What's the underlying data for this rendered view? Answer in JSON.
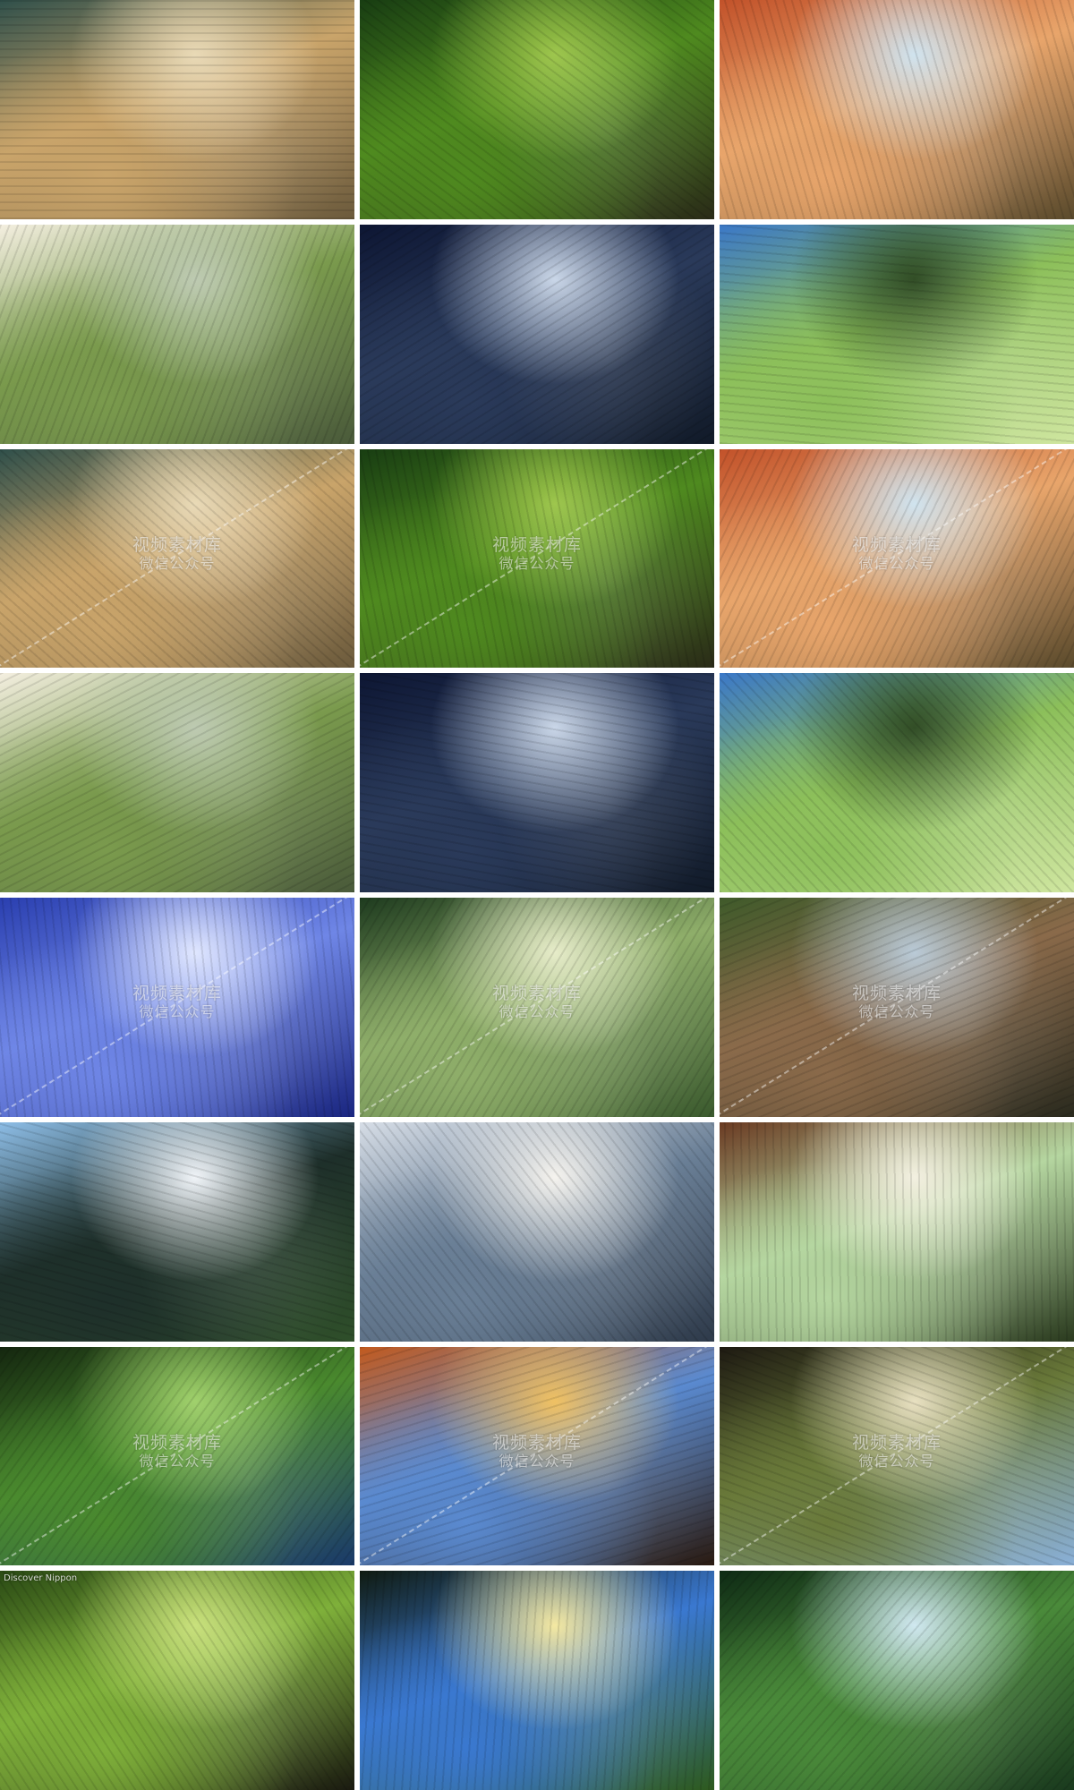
{
  "gallery": {
    "columns": 3,
    "rows": 8,
    "tiles": [
      {
        "scene": "frosted-grass-bokeh",
        "colors": [
          "#2f4f4a",
          "#c9a46a",
          "#e9d9b5",
          "#6b5a3c"
        ]
      },
      {
        "scene": "mossy-tree-roots",
        "colors": [
          "#183d12",
          "#4f8a1f",
          "#9cc54a",
          "#2a2b18"
        ]
      },
      {
        "scene": "autumn-tree-by-lake",
        "colors": [
          "#c2522a",
          "#e8a56b",
          "#cfe3ef",
          "#5a4a2c"
        ]
      },
      {
        "scene": "snowy-pine-branch-sunlight",
        "colors": [
          "#f4efe0",
          "#7a9a4d",
          "#bcc9b0",
          "#4a5a3a"
        ]
      },
      {
        "scene": "misty-dark-forest-light",
        "colors": [
          "#0d1633",
          "#2a3a5a",
          "#c9d6e8",
          "#111a28"
        ]
      },
      {
        "scene": "green-canopy-blue-sky",
        "colors": [
          "#3b78c8",
          "#8cbf5a",
          "#2e4a22",
          "#cfe6a0"
        ]
      },
      {
        "scene": "frosted-grass-bokeh",
        "colors": [
          "#2f4f4a",
          "#c9a46a",
          "#e9d9b5",
          "#6b5a3c"
        ]
      },
      {
        "scene": "mossy-tree-roots",
        "colors": [
          "#183d12",
          "#4f8a1f",
          "#9cc54a",
          "#2a2b18"
        ]
      },
      {
        "scene": "autumn-tree-by-lake",
        "colors": [
          "#c2522a",
          "#e8a56b",
          "#cfe3ef",
          "#5a4a2c"
        ]
      },
      {
        "scene": "snowy-pine-branch-sunlight",
        "colors": [
          "#f4efe0",
          "#7a9a4d",
          "#bcc9b0",
          "#4a5a3a"
        ]
      },
      {
        "scene": "misty-dark-forest-light",
        "colors": [
          "#0d1633",
          "#2a3a5a",
          "#c9d6e8",
          "#111a28"
        ]
      },
      {
        "scene": "green-canopy-blue-sky",
        "colors": [
          "#3b78c8",
          "#8cbf5a",
          "#2e4a22",
          "#cfe6a0"
        ]
      },
      {
        "scene": "aerial-snowy-forest-blue",
        "colors": [
          "#2a3fb0",
          "#6f86e6",
          "#dfe6ff",
          "#1a2680"
        ]
      },
      {
        "scene": "misty-pine-clearing",
        "colors": [
          "#1d3a1e",
          "#8fae6a",
          "#e6ecc8",
          "#3b5a2e"
        ]
      },
      {
        "scene": "oak-tree-meadow-path",
        "colors": [
          "#3f5a2a",
          "#8a6a4a",
          "#b8c9d6",
          "#2a2a1e"
        ]
      },
      {
        "scene": "snowy-mountain-pines",
        "colors": [
          "#8dbde6",
          "#1e2f2a",
          "#f0f4f8",
          "#2f4f2a"
        ]
      },
      {
        "scene": "snow-covered-fir-trees",
        "colors": [
          "#d6dde6",
          "#6a7f96",
          "#f5f3ee",
          "#2e3a4a"
        ]
      },
      {
        "scene": "sequoia-forest-sunlight",
        "colors": [
          "#6a3a22",
          "#b5d6a0",
          "#f3f0e0",
          "#2a3a1e"
        ]
      },
      {
        "scene": "canopy-looking-up-green",
        "colors": [
          "#14260f",
          "#4a8a2e",
          "#9fd06a",
          "#1a3a6a"
        ]
      },
      {
        "scene": "autumn-canopy-blue-sky",
        "colors": [
          "#c25a1e",
          "#5a8ad0",
          "#f0c060",
          "#2a1a10"
        ]
      },
      {
        "scene": "oak-branches-sunburst",
        "colors": [
          "#1e1a12",
          "#6a7a3a",
          "#e8e0c0",
          "#8ab0d8"
        ]
      },
      {
        "scene": "mossy-trunk-closeup",
        "colors": [
          "#2a4a14",
          "#7fb03a",
          "#c8e07a",
          "#1a1a10"
        ]
      },
      {
        "scene": "lone-tree-sunburst",
        "colors": [
          "#0f1a10",
          "#3a78d0",
          "#f4e8a0",
          "#2e5a1e"
        ]
      },
      {
        "scene": "tall-trees-looking-up",
        "colors": [
          "#0e2a14",
          "#4a8a3a",
          "#cfe8f0",
          "#1a3a1e"
        ]
      }
    ],
    "watermark": {
      "line1": "视频素材库",
      "line2": "微信公众号",
      "tiles": [
        6,
        7,
        8,
        12,
        13,
        14,
        18,
        19,
        20
      ]
    },
    "credit": {
      "text": "Discover Nippon",
      "tile": 21
    }
  }
}
